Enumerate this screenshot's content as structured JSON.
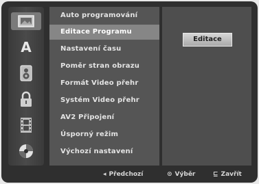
{
  "sidebar": {
    "icons": [
      {
        "name": "picture-icon",
        "selected": true
      },
      {
        "name": "language-icon",
        "glyph": "A"
      },
      {
        "name": "audio-icon"
      },
      {
        "name": "lock-icon"
      },
      {
        "name": "filmstrip-icon"
      },
      {
        "name": "disc-icon"
      }
    ]
  },
  "menu": {
    "items": [
      {
        "label": "Auto programování"
      },
      {
        "label": "Editace Programu",
        "selected": true
      },
      {
        "label": "Nastavení času"
      },
      {
        "label": "Poměr stran obrazu"
      },
      {
        "label": "Formát Video přehr"
      },
      {
        "label": "Systém Video přehr"
      },
      {
        "label": "AV2 Připojení"
      },
      {
        "label": "Úsporný režim"
      },
      {
        "label": "Výchozí nastavení"
      }
    ]
  },
  "detail": {
    "button_label": "Editace"
  },
  "legend": {
    "back": {
      "glyph": "◂",
      "label": "Předchozí"
    },
    "select": {
      "glyph": "⊙",
      "label": "Výběr"
    },
    "close": {
      "glyph": "⊑",
      "label": "Zavřít"
    }
  },
  "colors": {
    "screen_bg": "#2f2f2f",
    "menu_bg": "#555555",
    "selected_bg": "#868686",
    "text": "#e4e4e4"
  }
}
